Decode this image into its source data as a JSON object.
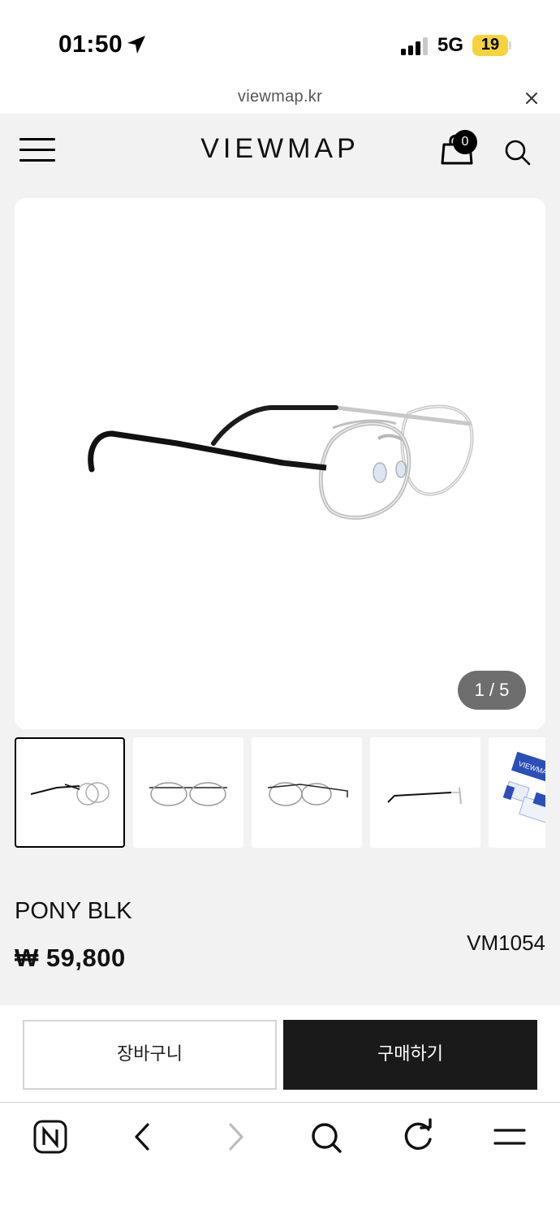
{
  "status_bar": {
    "time": "01:50",
    "network": "5G",
    "battery": "19",
    "icons": [
      "location-arrow-icon",
      "signal-bars-icon",
      "battery-icon"
    ]
  },
  "browser": {
    "url": "viewmap.kr",
    "close_icon": "close-icon"
  },
  "header": {
    "logo": "VIEWMAP",
    "cart_count": "0",
    "icons": [
      "hamburger-menu-icon",
      "shopping-bag-icon",
      "search-icon"
    ]
  },
  "gallery": {
    "pager": "1 / 5",
    "thumbnails": [
      {
        "label": "side-view",
        "active": true
      },
      {
        "label": "front-view",
        "active": false
      },
      {
        "label": "angle-view",
        "active": false
      },
      {
        "label": "profile-view",
        "active": false
      },
      {
        "label": "package-view",
        "active": false
      }
    ],
    "package_text": "VIEWMAP"
  },
  "product": {
    "name": "PONY BLK",
    "price": "₩ 59,800",
    "code": "VM1054"
  },
  "actions": {
    "cart_label": "장바구니",
    "buy_label": "구매하기"
  },
  "toolbar": {
    "icons": [
      "naver-home-icon",
      "back-icon",
      "forward-icon",
      "search-icon",
      "reload-icon",
      "menu-icon"
    ]
  },
  "colors": {
    "battery": "#f4d33b",
    "buy_button": "#1a1a1a",
    "page_background": "#f2f2f2",
    "pager_background": "#6e6e6e"
  }
}
